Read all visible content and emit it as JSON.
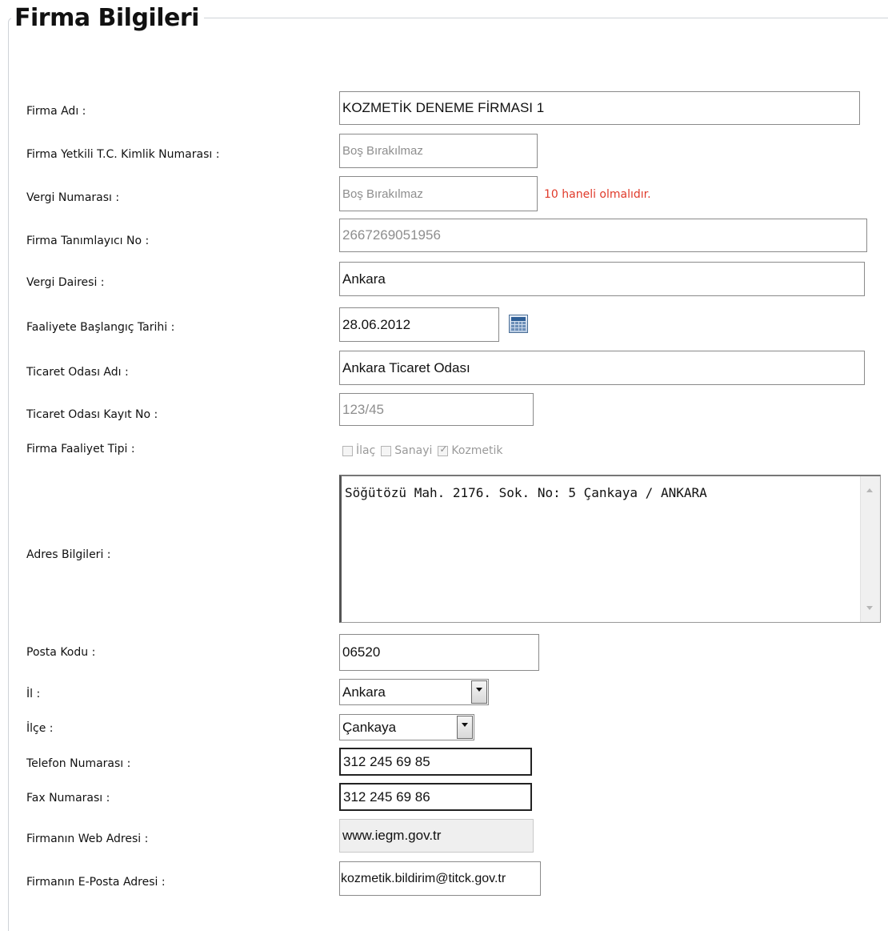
{
  "section": {
    "title": "Firma Bilgileri"
  },
  "fields": {
    "firma_adi": {
      "label": "Firma Adı :",
      "value": "KOZMETİK DENEME FİRMASI 1"
    },
    "tc_kimlik": {
      "label": "Firma Yetkili T.C. Kimlik Numarası :",
      "placeholder": "Boş Bırakılmaz"
    },
    "vergi_no": {
      "label": "Vergi Numarası :",
      "placeholder": "Boş Bırakılmaz",
      "error": "10 haneli olmalıdır."
    },
    "tanimlayici_no": {
      "label": "Firma Tanımlayıcı No :",
      "value": "2667269051956"
    },
    "vergi_dairesi": {
      "label": "Vergi Dairesi :",
      "value": "Ankara"
    },
    "baslangic_tarihi": {
      "label": "Faaliyete Başlangıç Tarihi :",
      "value": "28.06.2012"
    },
    "ticaret_odasi_adi": {
      "label": "Ticaret Odası Adı :",
      "value": "Ankara Ticaret Odası"
    },
    "ticaret_odasi_kayit": {
      "label": "Ticaret Odası Kayıt No :",
      "value": "123/45"
    },
    "faaliyet_tipi": {
      "label": "Firma Faaliyet Tipi :",
      "options": [
        {
          "label": "İlaç",
          "checked": false
        },
        {
          "label": "Sanayi",
          "checked": false
        },
        {
          "label": "Kozmetik",
          "checked": true
        }
      ]
    },
    "adres": {
      "label": "Adres Bilgileri :",
      "value": "Söğütözü Mah. 2176. Sok. No: 5 Çankaya / ANKARA"
    },
    "posta_kodu": {
      "label": "Posta Kodu :",
      "value": "06520"
    },
    "il": {
      "label": "İl :",
      "value": "Ankara"
    },
    "ilce": {
      "label": "İlçe :",
      "value": "Çankaya"
    },
    "telefon": {
      "label": "Telefon Numarası :",
      "value": "312 245 69 85"
    },
    "fax": {
      "label": "Fax Numarası :",
      "value": "312 245 69 86"
    },
    "web": {
      "label": "Firmanın Web Adresi :",
      "value": "www.iegm.gov.tr"
    },
    "eposta": {
      "label": "Firmanın E-Posta Adresi :",
      "value": "kozmetik.bildirim@titck.gov.tr"
    }
  },
  "icons": {
    "calendar": "calendar-icon",
    "dropdown": "chevron-down-icon"
  },
  "colors": {
    "error": "#e03a2a",
    "border": "#8a8a8a",
    "readonly_text": "#8e8e8e"
  }
}
